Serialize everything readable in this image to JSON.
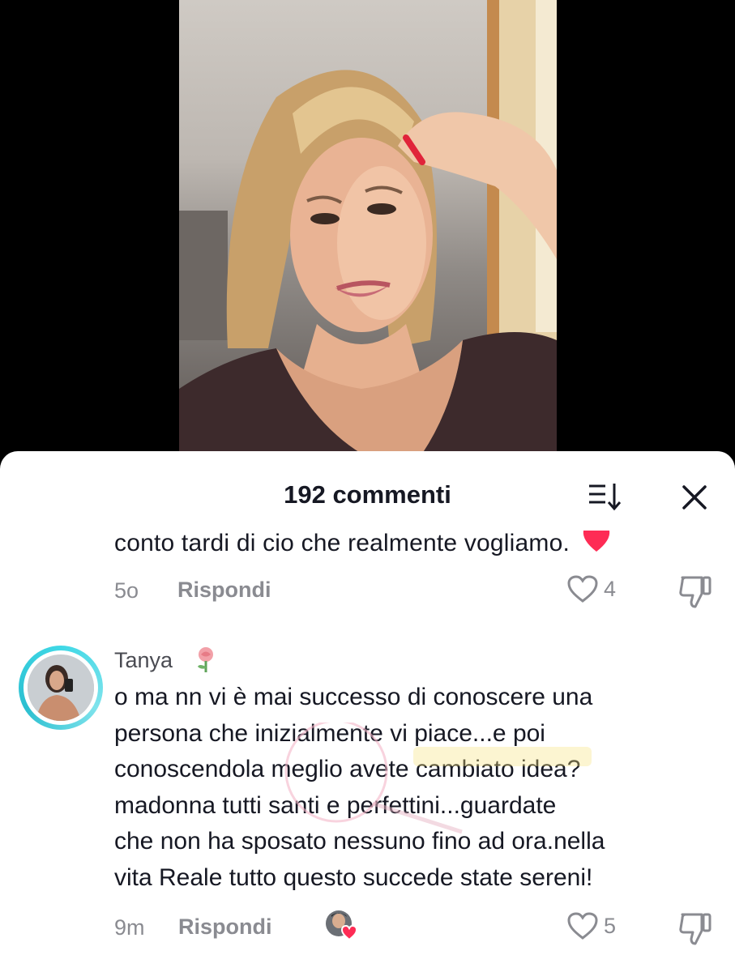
{
  "comments_sheet": {
    "title": "192 commenti",
    "sort_icon": "sort-descending-icon",
    "close_icon": "close-icon"
  },
  "previous_comment": {
    "text_fragment": "conto tardi di cio che realmente vogliamo.",
    "emoji": "heart-emoji",
    "time": "5o",
    "reply_label": "Rispondi",
    "likes": "4"
  },
  "comment": {
    "username": "Tanya",
    "username_emoji": "rose-emoji",
    "lines": [
      "o ma nn vi è mai successo di conoscere una",
      "persona che inizialmente vi piace...e poi",
      "conoscendola meglio avete cambiato idea?",
      "madonna tutti santi e perfettini...guardate",
      "che non ha sposato nessuno fino ad ora.nella",
      "vita Reale tutto questo succede state sereni!"
    ],
    "time": "9m",
    "reply_label": "Rispondi",
    "likes": "5",
    "liked_by_creator_icon": "creator-liked-avatar-icon"
  },
  "colors": {
    "accent_ring": "#3fd8e6",
    "heart_red": "#fe2c55",
    "text_primary": "#161823",
    "text_secondary": "#8a8b91"
  }
}
